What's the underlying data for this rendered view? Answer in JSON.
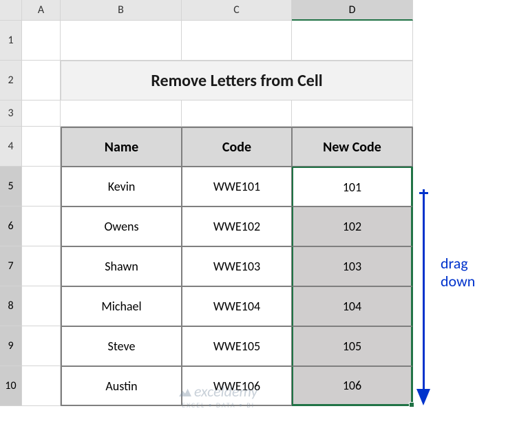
{
  "columns": [
    "A",
    "B",
    "C",
    "D"
  ],
  "rows": [
    "1",
    "2",
    "3",
    "4",
    "5",
    "6",
    "7",
    "8",
    "9",
    "10"
  ],
  "title": "Remove Letters from Cell",
  "headers": {
    "name": "Name",
    "code": "Code",
    "newcode": "New Code"
  },
  "data": [
    {
      "name": "Kevin",
      "code": "WWE101",
      "newcode": "101"
    },
    {
      "name": "Owens",
      "code": "WWE102",
      "newcode": "102"
    },
    {
      "name": "Shawn",
      "code": "WWE103",
      "newcode": "103"
    },
    {
      "name": "Michael",
      "code": "WWE104",
      "newcode": "104"
    },
    {
      "name": "Steve",
      "code": "WWE105",
      "newcode": "105"
    },
    {
      "name": "Austin",
      "code": "WWE106",
      "newcode": "106"
    }
  ],
  "annotation": {
    "line1": "drag",
    "line2": "down"
  },
  "watermark": {
    "brand": "exceldemy",
    "tag": "EXCEL • DATA • BI"
  }
}
